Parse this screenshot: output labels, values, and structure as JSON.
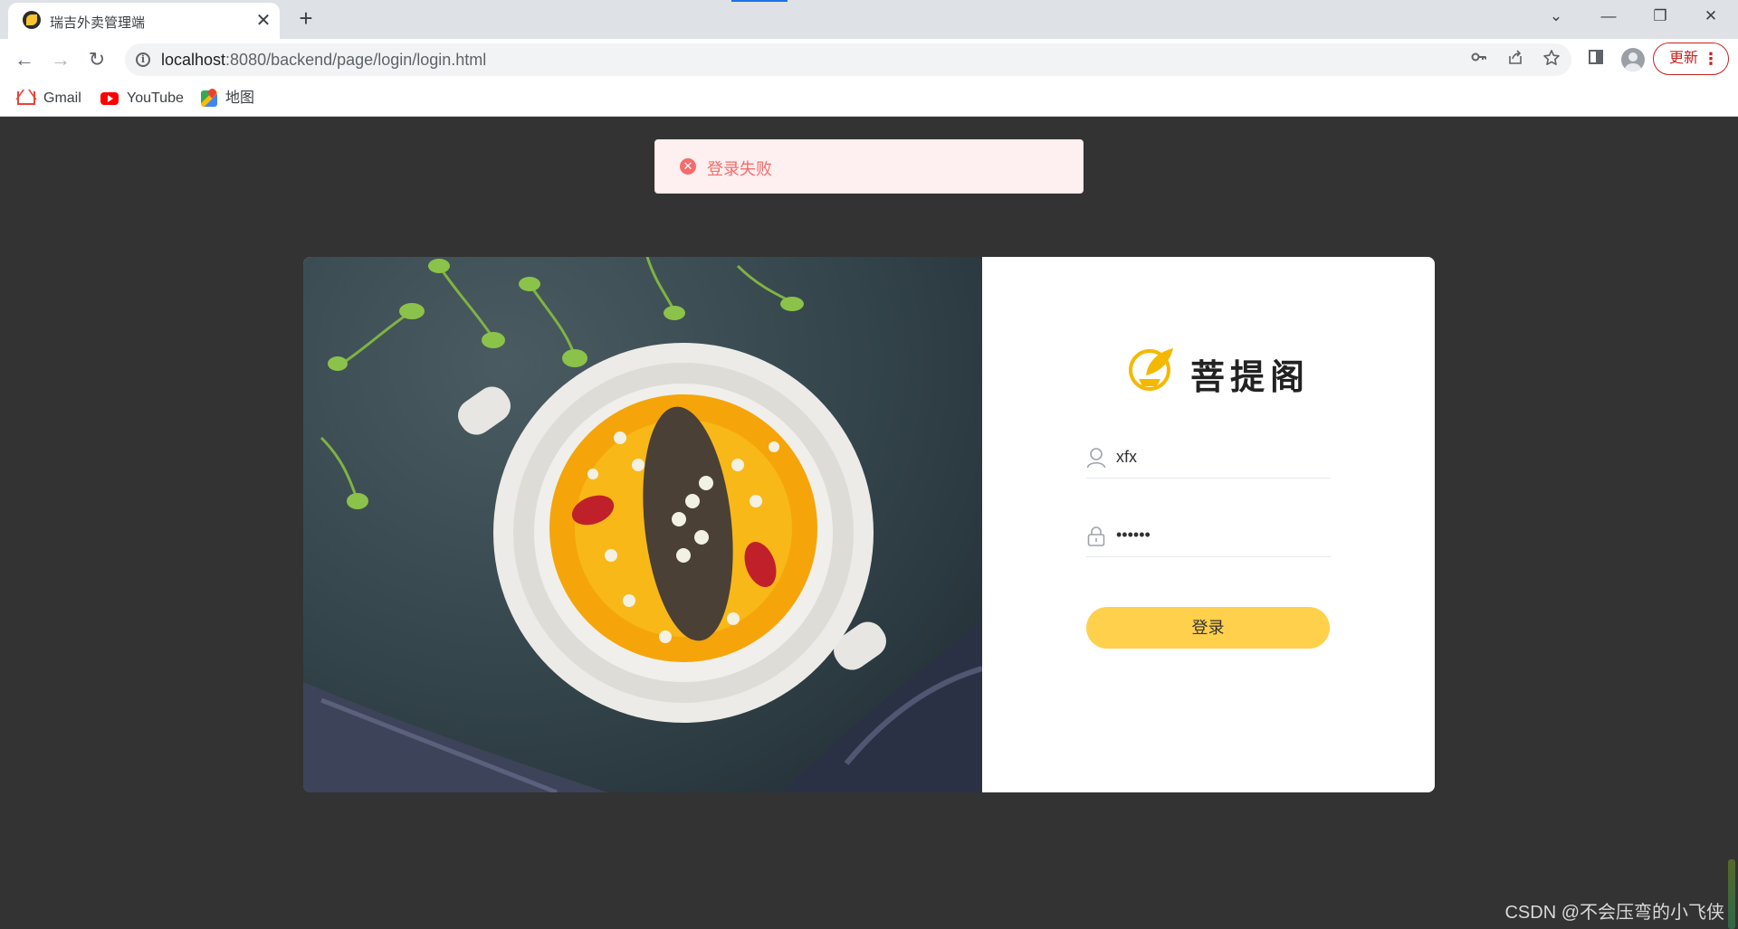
{
  "browser": {
    "tab_title": "瑞吉外卖管理端",
    "tab_close": "✕",
    "new_tab": "+",
    "url_host": "localhost",
    "url_rest": ":8080/backend/page/login/login.html",
    "update_label": "更新",
    "window_controls": {
      "tab_search": "⌄",
      "minimize": "—",
      "restore": "❐",
      "close": "✕"
    },
    "nav": {
      "back": "←",
      "forward": "→",
      "reload": "↻"
    },
    "icons": {
      "password_key": "key-icon",
      "share": "share-icon",
      "bookmark": "star-icon",
      "side_panel": "side-panel-icon",
      "profile": "profile-icon",
      "menu": "more-vert-icon"
    }
  },
  "bookmarks": [
    {
      "label": "Gmail",
      "icon": "gmail-icon"
    },
    {
      "label": "YouTube",
      "icon": "youtube-icon"
    },
    {
      "label": "地图",
      "icon": "maps-icon"
    }
  ],
  "alert": {
    "text": "登录失败",
    "type": "error",
    "color": "#f56c6c"
  },
  "login": {
    "brand_name": "菩提阁",
    "username_value": "xfx",
    "password_value": "••••••",
    "submit_label": "登录",
    "accent_color": "#ffd04b"
  },
  "watermark": "CSDN @不会压弯的小飞侠"
}
